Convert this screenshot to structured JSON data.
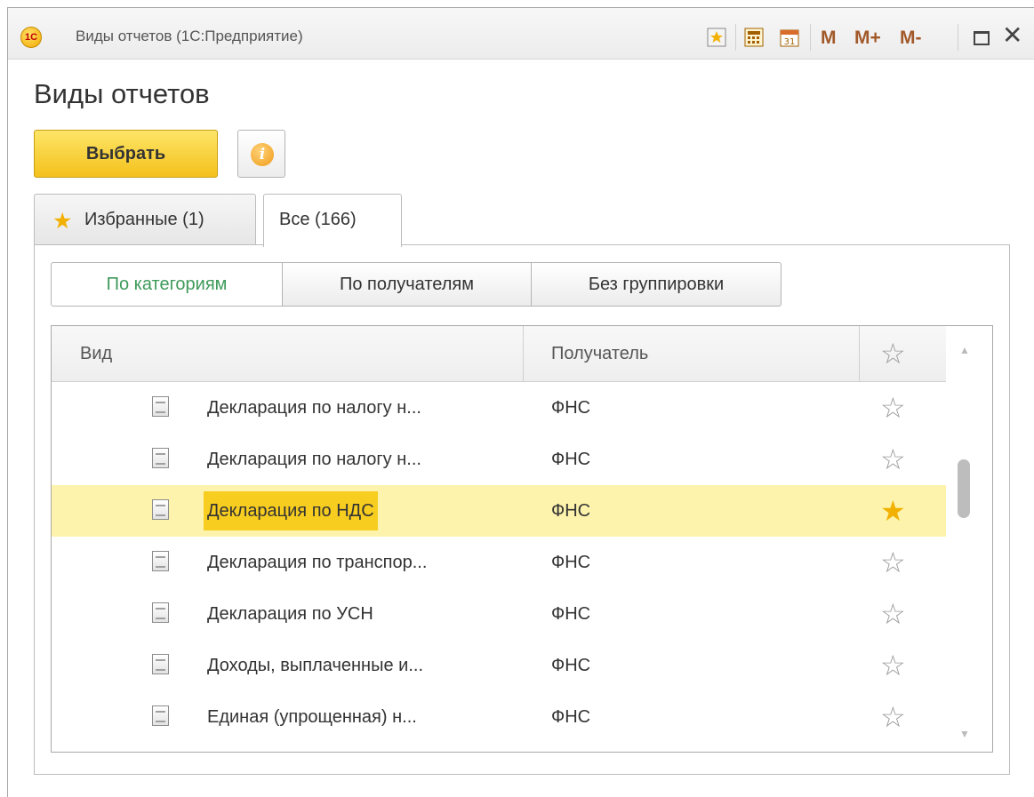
{
  "window": {
    "title": "Виды отчетов  (1С:Предприятие)",
    "logo_text": "1С",
    "toolbar": {
      "m": "M",
      "m_plus": "M+",
      "m_minus": "M-",
      "close": "✕",
      "calendar_day": "31"
    }
  },
  "form": {
    "title": "Виды отчетов",
    "select_label": "Выбрать",
    "info_glyph": "i"
  },
  "tabs": [
    {
      "label": "Избранные (1)",
      "icon": "star-icon",
      "active": false
    },
    {
      "label": "Все (166)",
      "active": true
    }
  ],
  "grouping": [
    {
      "label": "По категориям",
      "active": true
    },
    {
      "label": "По получателям",
      "active": false
    },
    {
      "label": "Без группировки",
      "active": false
    }
  ],
  "table": {
    "columns": {
      "vid": "Вид",
      "recipient": "Получатель",
      "favorite_icon": "star-outline-icon"
    },
    "rows": [
      {
        "name": "Декларация по налогу н...",
        "recipient": "ФНС",
        "favorite": false,
        "selected": false
      },
      {
        "name": "Декларация по налогу н...",
        "recipient": "ФНС",
        "favorite": false,
        "selected": false
      },
      {
        "name": "Декларация по НДС",
        "recipient": "ФНС",
        "favorite": true,
        "selected": true
      },
      {
        "name": "Декларация по транспор...",
        "recipient": "ФНС",
        "favorite": false,
        "selected": false
      },
      {
        "name": "Декларация по УСН",
        "recipient": "ФНС",
        "favorite": false,
        "selected": false
      },
      {
        "name": "Доходы, выплаченные и...",
        "recipient": "ФНС",
        "favorite": false,
        "selected": false
      },
      {
        "name": "Единая (упрощенная) н...",
        "recipient": "ФНС",
        "favorite": false,
        "selected": false
      }
    ]
  },
  "colors": {
    "select_button": "#f4c11c",
    "selected_row": "#fdf3ac",
    "selected_cell": "#f7cd1f",
    "active_grouping_text": "#3f9a5b",
    "favorite_star": "#f2b000"
  }
}
